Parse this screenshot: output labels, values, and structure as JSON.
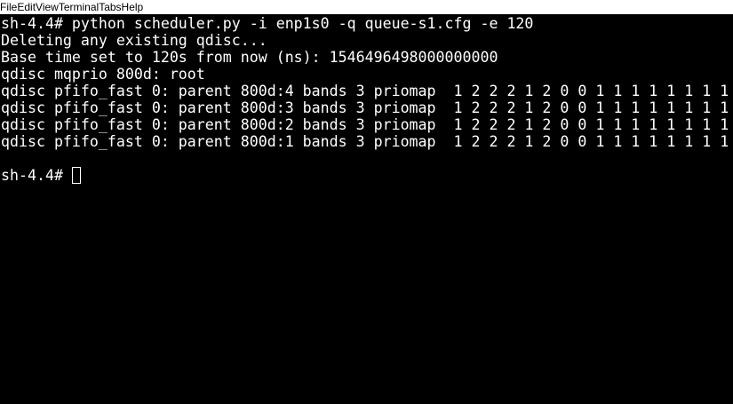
{
  "menu": {
    "items": [
      "File",
      "Edit",
      "View",
      "Terminal",
      "Tabs",
      "Help"
    ]
  },
  "terminal": {
    "lines": [
      "sh-4.4# python scheduler.py -i enp1s0 -q queue-s1.cfg -e 120",
      "Deleting any existing qdisc...",
      "Base time set to 120s from now (ns): 1546496498000000000",
      "qdisc mqprio 800d: root",
      "qdisc pfifo_fast 0: parent 800d:4 bands 3 priomap  1 2 2 2 1 2 0 0 1 1 1 1 1 1 1 1",
      "qdisc pfifo_fast 0: parent 800d:3 bands 3 priomap  1 2 2 2 1 2 0 0 1 1 1 1 1 1 1 1",
      "qdisc pfifo_fast 0: parent 800d:2 bands 3 priomap  1 2 2 2 1 2 0 0 1 1 1 1 1 1 1 1",
      "qdisc pfifo_fast 0: parent 800d:1 bands 3 priomap  1 2 2 2 1 2 0 0 1 1 1 1 1 1 1 1",
      ""
    ],
    "prompt": "sh-4.4# ",
    "input": ""
  },
  "colors": {
    "background": "#000000",
    "foreground": "#ffffff",
    "menubar": "#ffffff"
  }
}
